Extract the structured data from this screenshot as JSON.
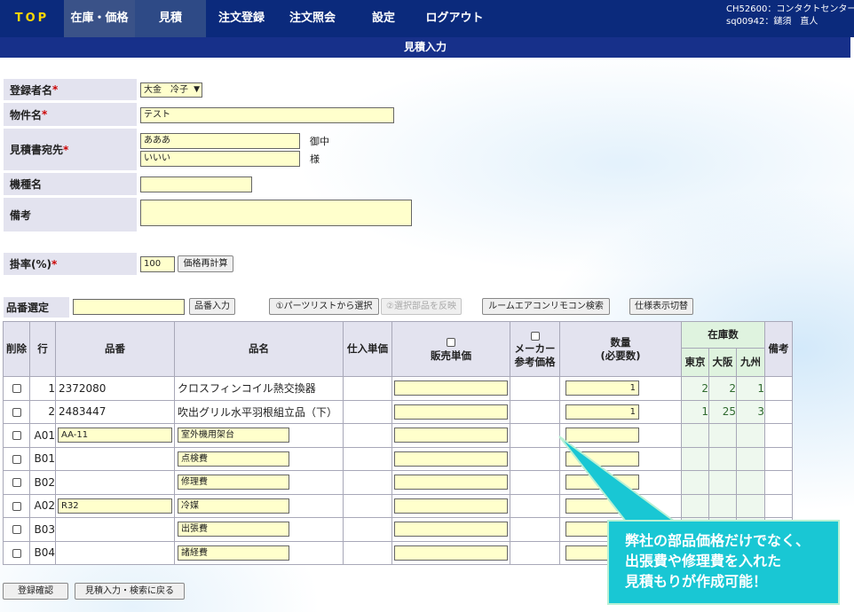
{
  "nav": {
    "logo": "TOP",
    "items": [
      "在庫・価格",
      "見積",
      "注文登録",
      "注文照会",
      "設定",
      "ログアウト"
    ],
    "user_line1": "CH52600：コンタクトセンター",
    "user_line2": "sq00942：鑓須　直人"
  },
  "page_title": "見積入力",
  "form": {
    "registrant_label": "登録者名",
    "registrant_value": "大金　冷子",
    "project_label": "物件名",
    "project_value": "テスト",
    "recipient_label": "見積書宛先",
    "recipient_value1": "あああ",
    "recipient_suffix1": "御中",
    "recipient_value2": "いいい",
    "recipient_suffix2": "様",
    "model_label": "機種名",
    "model_value": "",
    "remarks_label": "備考",
    "remarks_value": "",
    "rate_label": "掛率(%)",
    "rate_value": "100",
    "recalc_button": "価格再計算",
    "required_mark": "*"
  },
  "part_select": {
    "label": "品番選定",
    "input_value": "",
    "part_entry_button": "品番入力",
    "parts_list_button": "①パーツリストから選択",
    "reflect_button": "②選択部品を反映",
    "remote_search_button": "ルームエアコンリモコン検索",
    "spec_toggle_button": "仕様表示切替"
  },
  "table": {
    "headers": {
      "delete": "削除",
      "row": "行",
      "part_no": "品番",
      "part_name": "品名",
      "purchase_price": "仕入単価",
      "sale_price": "販売単価",
      "maker_price_1": "メーカー",
      "maker_price_2": "参考価格",
      "qty_1": "数量",
      "qty_2": "(必要数)",
      "stock": "在庫数",
      "tokyo": "東京",
      "osaka": "大阪",
      "kyushu": "九州",
      "note": "備考"
    },
    "rows": [
      {
        "row": "1",
        "part_no": "2372080",
        "part_name": "クロスフィンコイル熱交換器",
        "qty": "1",
        "tokyo": "2",
        "osaka": "2",
        "kyushu": "1"
      },
      {
        "row": "2",
        "part_no": "2483447",
        "part_name": "吹出グリル水平羽根組立品（下）",
        "qty": "1",
        "tokyo": "1",
        "osaka": "25",
        "kyushu": "3"
      },
      {
        "row": "A01",
        "part_no": "AA-11",
        "part_name": "室外機用架台",
        "qty": "",
        "tokyo": "",
        "osaka": "",
        "kyushu": ""
      },
      {
        "row": "B01",
        "part_no": "",
        "part_name": "点検費",
        "qty": "",
        "tokyo": "",
        "osaka": "",
        "kyushu": ""
      },
      {
        "row": "B02",
        "part_no": "",
        "part_name": "修理費",
        "qty": "",
        "tokyo": "",
        "osaka": "",
        "kyushu": ""
      },
      {
        "row": "A02",
        "part_no": "R32",
        "part_name": "冷媒",
        "qty": "",
        "tokyo": "",
        "osaka": "",
        "kyushu": ""
      },
      {
        "row": "B03",
        "part_no": "",
        "part_name": "出張費",
        "qty": "",
        "tokyo": "",
        "osaka": "",
        "kyushu": ""
      },
      {
        "row": "B04",
        "part_no": "",
        "part_name": "諸経費",
        "qty": "",
        "tokyo": "",
        "osaka": "",
        "kyushu": ""
      }
    ]
  },
  "buttons": {
    "confirm": "登録確認",
    "back": "見積入力・検索に戻る"
  },
  "callout": {
    "line1": "弊社の部品価格だけでなく、",
    "line2": "出張費や修理費を入れた",
    "line3": "見積もりが作成可能！"
  },
  "colors": {
    "nav_bg": "#0b2a7c",
    "logo": "#ffd700",
    "input_bg": "#ffffcc",
    "label_bg": "#e3e3ef",
    "stock_bg": "#dff3df",
    "callout_bg": "#19c7d4"
  }
}
